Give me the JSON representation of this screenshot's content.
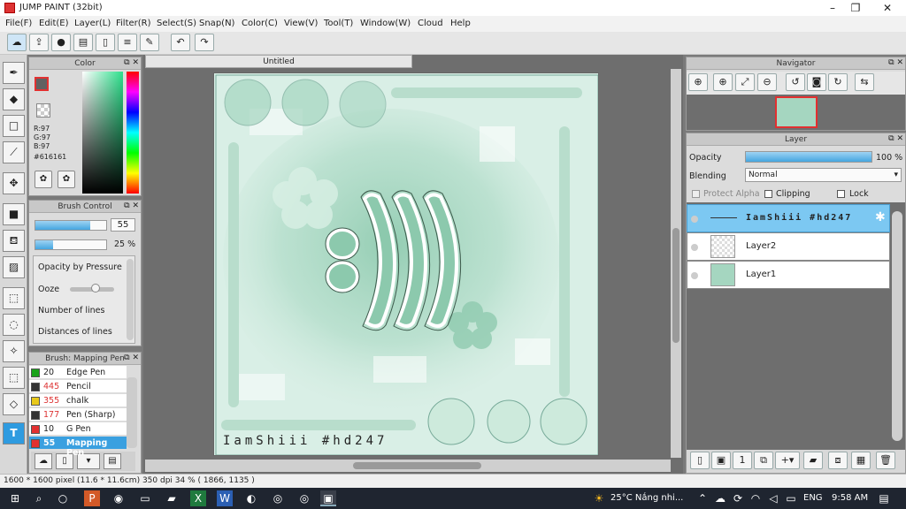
{
  "window": {
    "title": "JUMP PAINT (32bit)",
    "minimize": "–",
    "maximize": "❐",
    "close": "✕"
  },
  "menu": [
    "File(F)",
    "Edit(E)",
    "Layer(L)",
    "Filter(R)",
    "Select(S)",
    "Snap(N)",
    "Color(C)",
    "View(V)",
    "Tool(T)",
    "Window(W)",
    "Cloud",
    "Help"
  ],
  "color_panel": {
    "title": "Color",
    "r": "R:97",
    "g": "G:97",
    "b": "B:97",
    "hex": "#616161"
  },
  "brush_control": {
    "title": "Brush Control",
    "size": "55",
    "opacity": "25 %",
    "opacity_by_pressure": "Opacity by Pressure",
    "ooze": "Ooze",
    "number_of_lines": "Number of lines",
    "distances_of_lines": "Distances of lines"
  },
  "brush_list": {
    "title": "Brush: Mapping Pen",
    "items": [
      {
        "num": "20",
        "name": "Edge Pen",
        "color": "#1aa31a"
      },
      {
        "num": "445",
        "name": "Pencil",
        "color": "#333333"
      },
      {
        "num": "355",
        "name": "chalk",
        "color": "#e8c81a"
      },
      {
        "num": "177",
        "name": "Pen (Sharp)",
        "color": "#333333"
      },
      {
        "num": "10",
        "name": "G Pen",
        "color": "#e23030"
      },
      {
        "num": "55",
        "name": "Mapping Pen",
        "color": "#e23030"
      }
    ]
  },
  "document": {
    "tab": "Untitled",
    "signature": "IamShiii #hd247"
  },
  "navigator": {
    "title": "Navigator"
  },
  "layer_panel": {
    "title": "Layer",
    "opacity_label": "Opacity",
    "opacity_value": "100 %",
    "blending_label": "Blending",
    "blending_value": "Normal",
    "protect_alpha": "Protect Alpha",
    "clipping": "Clipping",
    "lock": "Lock",
    "layers": [
      {
        "name": "IamShiii #hd247",
        "selected": true
      },
      {
        "name": "Layer2",
        "selected": false
      },
      {
        "name": "Layer1",
        "selected": false
      }
    ]
  },
  "status": {
    "text": "1600 * 1600 pixel  (11.6 * 11.6cm)  350 dpi  34 %  ( 1866, 1135 )"
  },
  "taskbar": {
    "weather": "25°C  Nắng nhi...",
    "lang": "ENG",
    "time": "9:58 AM"
  },
  "colors": {
    "accent": "#5bb8e8",
    "mint": "#8cc9ad",
    "mint_dark": "#6fae92"
  }
}
